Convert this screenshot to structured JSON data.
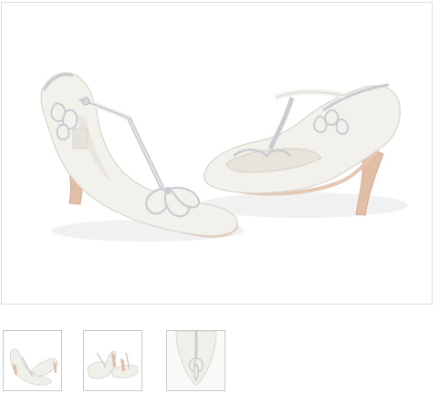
{
  "gallery": {
    "main_image": {
      "subject": "pair-of-ivory-t-bar-heels-with-silver-petal-trim",
      "colors": {
        "leather": "#f3f1ec",
        "leather_shade": "#dedbd3",
        "trim": "#c9ccd1",
        "sole": "#e6c7b3",
        "heel": "#e2bea7",
        "shadow": "#ececec"
      }
    },
    "thumbnails": [
      {
        "view": "pair-three-quarter",
        "selected": true
      },
      {
        "view": "pair-side-by-side",
        "selected": false
      },
      {
        "view": "toe-detail-closeup",
        "selected": false
      }
    ]
  }
}
